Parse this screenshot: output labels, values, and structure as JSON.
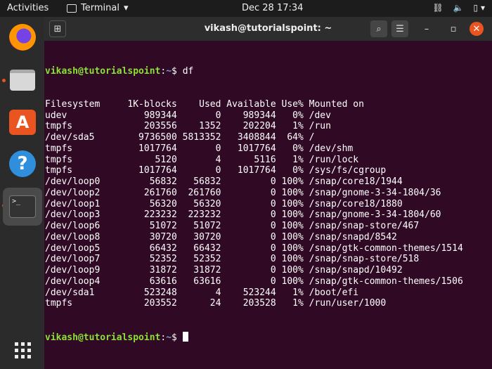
{
  "topbar": {
    "activities": "Activities",
    "app": "Terminal",
    "clock": "Dec 28  17:34"
  },
  "window": {
    "title": "vikash@tutorialspoint: ~"
  },
  "terminal": {
    "prompt_user": "vikash@tutorialspoint",
    "prompt_sep": ":",
    "prompt_path": "~",
    "prompt_end": "$",
    "command": "df",
    "headers": [
      "Filesystem",
      "1K-blocks",
      "Used",
      "Available",
      "Use%",
      "Mounted on"
    ],
    "rows": [
      [
        "udev",
        "989344",
        "0",
        "989344",
        "0%",
        "/dev"
      ],
      [
        "tmpfs",
        "203556",
        "1352",
        "202204",
        "1%",
        "/run"
      ],
      [
        "/dev/sda5",
        "9736500",
        "5813352",
        "3408844",
        "64%",
        "/"
      ],
      [
        "tmpfs",
        "1017764",
        "0",
        "1017764",
        "0%",
        "/dev/shm"
      ],
      [
        "tmpfs",
        "5120",
        "4",
        "5116",
        "1%",
        "/run/lock"
      ],
      [
        "tmpfs",
        "1017764",
        "0",
        "1017764",
        "0%",
        "/sys/fs/cgroup"
      ],
      [
        "/dev/loop0",
        "56832",
        "56832",
        "0",
        "100%",
        "/snap/core18/1944"
      ],
      [
        "/dev/loop2",
        "261760",
        "261760",
        "0",
        "100%",
        "/snap/gnome-3-34-1804/36"
      ],
      [
        "/dev/loop1",
        "56320",
        "56320",
        "0",
        "100%",
        "/snap/core18/1880"
      ],
      [
        "/dev/loop3",
        "223232",
        "223232",
        "0",
        "100%",
        "/snap/gnome-3-34-1804/60"
      ],
      [
        "/dev/loop6",
        "51072",
        "51072",
        "0",
        "100%",
        "/snap/snap-store/467"
      ],
      [
        "/dev/loop8",
        "30720",
        "30720",
        "0",
        "100%",
        "/snap/snapd/8542"
      ],
      [
        "/dev/loop5",
        "66432",
        "66432",
        "0",
        "100%",
        "/snap/gtk-common-themes/1514"
      ],
      [
        "/dev/loop7",
        "52352",
        "52352",
        "0",
        "100%",
        "/snap/snap-store/518"
      ],
      [
        "/dev/loop9",
        "31872",
        "31872",
        "0",
        "100%",
        "/snap/snapd/10492"
      ],
      [
        "/dev/loop4",
        "63616",
        "63616",
        "0",
        "100%",
        "/snap/gtk-common-themes/1506"
      ],
      [
        "/dev/sda1",
        "523248",
        "4",
        "523244",
        "1%",
        "/boot/efi"
      ],
      [
        "tmpfs",
        "203552",
        "24",
        "203528",
        "1%",
        "/run/user/1000"
      ]
    ]
  },
  "colors": {
    "terminal_bg": "#300a24",
    "prompt_user": "#8ae234",
    "prompt_path": "#729fcf",
    "accent": "#e95420"
  }
}
